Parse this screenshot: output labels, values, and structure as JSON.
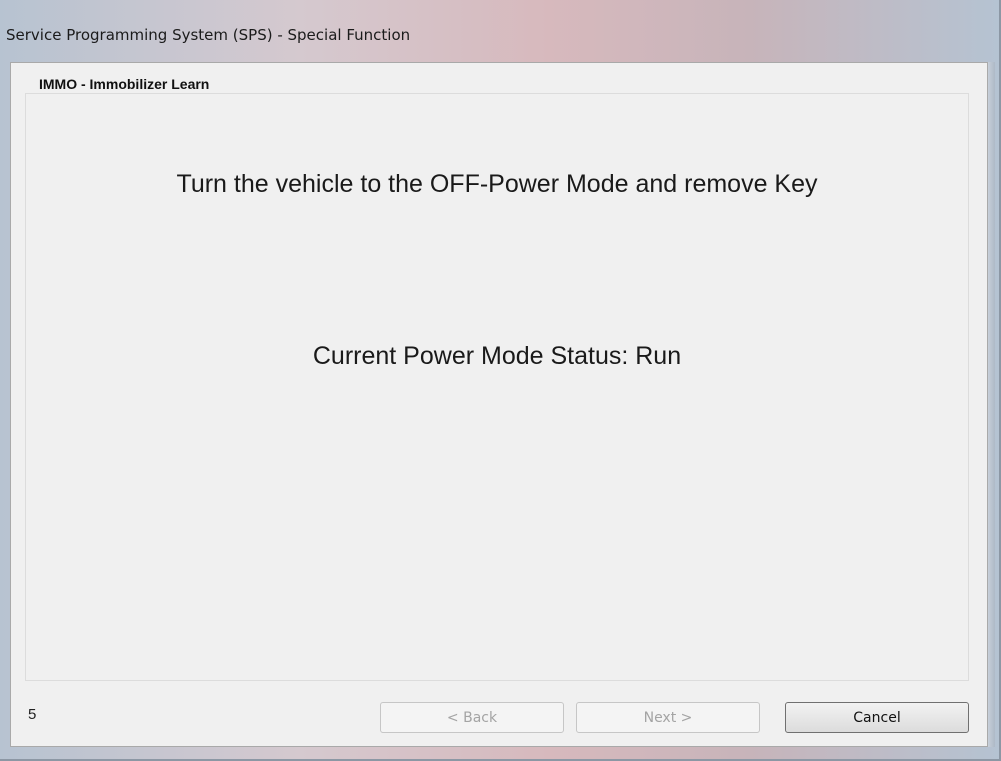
{
  "window": {
    "title": "Service Programming System (SPS) - Special Function"
  },
  "page": {
    "header": "IMMO - Immobilizer Learn",
    "instruction": "Turn the vehicle to the OFF-Power Mode and remove Key",
    "status": "Current Power Mode Status: Run"
  },
  "footer": {
    "step_number": "5",
    "back_label": "< Back",
    "next_label": "Next >",
    "cancel_label": "Cancel"
  }
}
